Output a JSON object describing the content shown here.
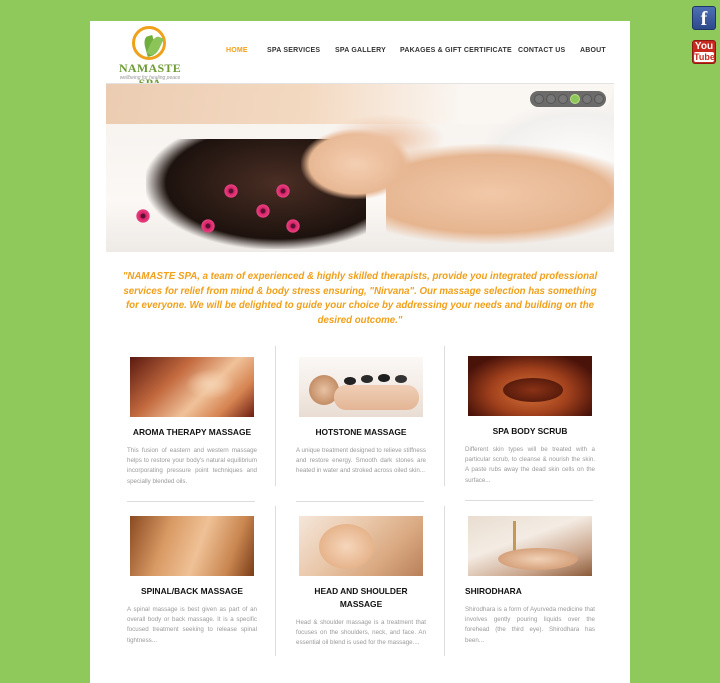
{
  "social": {
    "facebook_glyph": "f",
    "youtube_top": "You",
    "youtube_bottom": "Tube"
  },
  "logo": {
    "name": "NAMASTE SPA",
    "tagline": "wellbeing for healing peace"
  },
  "nav": {
    "items": [
      {
        "label": "HOME",
        "active": true
      },
      {
        "label": "SPA SERVICES"
      },
      {
        "label": "SPA GALLERY"
      },
      {
        "label": "PAKAGES & GIFT CERTIFICATE"
      },
      {
        "label": "CONTACT US"
      },
      {
        "label": "ABOUT"
      }
    ]
  },
  "slider": {
    "dot_count": 6,
    "active_dot": 4
  },
  "intro": "\"NAMASTE SPA, a team of experienced & highly skilled therapists, provide you integrated professional services for relief from mind & body stress ensuring, \"Nirvana\". Our massage selection has something for everyone. We will be delighted to guide your choice by addressing your needs and building on the desired outcome.\"",
  "services": [
    {
      "title": "AROMA THERAPY MASSAGE",
      "desc": "This fusion of eastern and western massage helps to restore your body's natural equilibrium incorporating pressure point techniques and specially blended oils."
    },
    {
      "title": "HOTSTONE MASSAGE",
      "desc": "A unique treatment designed to relieve stiffness and restore energy. Smooth dark stones are heated in water and stroked across oiled skin..."
    },
    {
      "title": "SPA BODY SCRUB",
      "desc": "Different skin types will be treated with a particular scrub, to cleanse & nourish the skin. A paste rubs away the dead skin cells on the surface..."
    },
    {
      "title": "SPINAL/BACK MASSAGE",
      "desc": "A spinal massage is best given as part of an overall body or back massage. It is a specific focused treatment seeking to release spinal tightness..."
    },
    {
      "title": "HEAD AND SHOULDER MASSAGE",
      "desc": "Head & shoulder massage is a treatment that focuses on the shoulders, neck, and face. An essential oil blend is used for the massage...."
    },
    {
      "title": "SHIRODHARA",
      "desc": "Shirodhara is a form of Ayurveda medicine that involves gently pouring liquids over the forehead (the third eye). Shirodhara has been..."
    }
  ],
  "colors": {
    "background": "#8fc95b",
    "accent": "#f0a01a",
    "logo_green": "#6d9b35"
  }
}
